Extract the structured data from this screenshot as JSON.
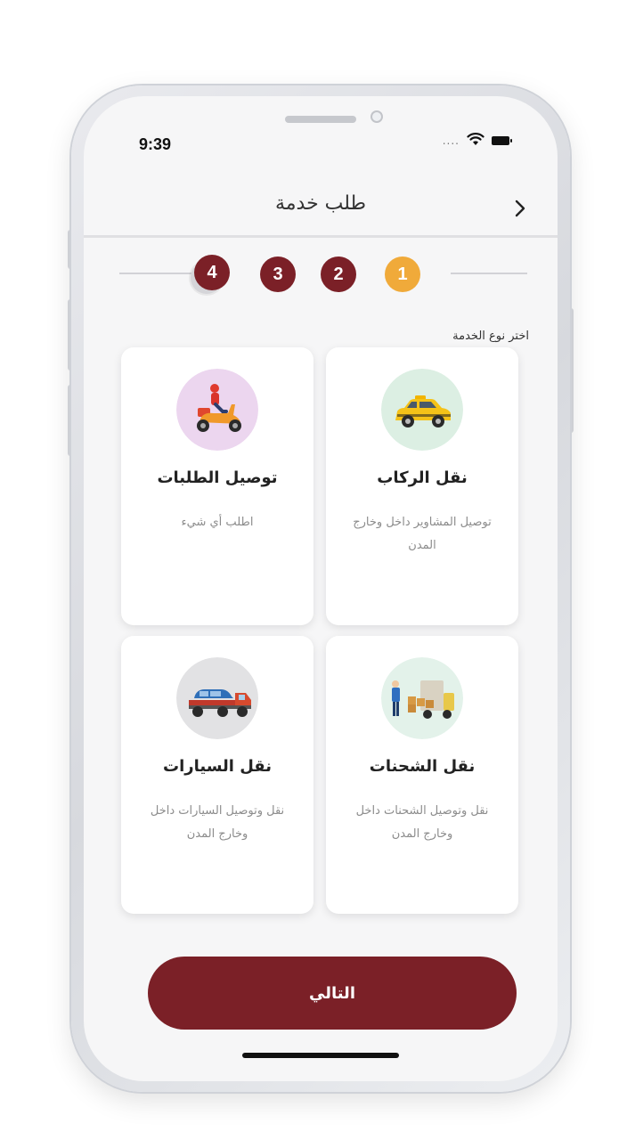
{
  "status_bar": {
    "time": "9:39",
    "signal_dots": "....",
    "wifi_icon": "wifi-icon",
    "battery_icon": "battery-icon"
  },
  "header": {
    "title": "طلب خدمة",
    "back_icon": "chevron-icon"
  },
  "stepper": {
    "steps": [
      "4",
      "3",
      "2",
      "1"
    ],
    "active_step": "1"
  },
  "prompt": "اختر نوع الخدمة",
  "services": [
    {
      "title": "نقل الركاب",
      "description": "توصيل المشاوير داخل وخارج المدن",
      "icon": "taxi-icon",
      "bg": "#dcefe3"
    },
    {
      "title": "توصيل الطلبات",
      "description": "اطلب أي شيء",
      "icon": "scooter-delivery-icon",
      "bg": "#ecd6ef"
    },
    {
      "title": "نقل الشحنات",
      "description": "نقل وتوصيل الشحنات داخل وخارج المدن",
      "icon": "cargo-truck-icon",
      "bg": "#e3f2ea"
    },
    {
      "title": "نقل السيارات",
      "description": "نقل وتوصيل السيارات داخل وخارج المدن",
      "icon": "tow-truck-icon",
      "bg": "#e2e2e4"
    }
  ],
  "next_button": "التالي",
  "colors": {
    "primary": "#7b2027",
    "active_step": "#f0aa3a"
  }
}
